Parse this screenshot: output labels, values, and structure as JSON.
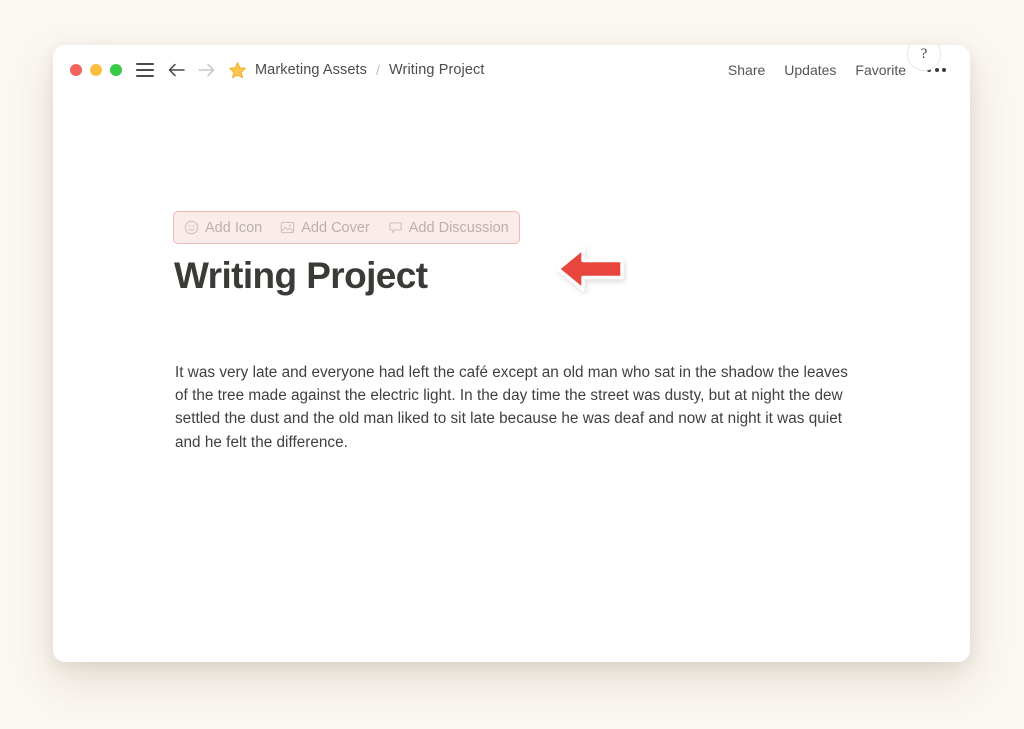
{
  "window": {
    "traffic_lights": [
      {
        "name": "close",
        "color": "#f2645a"
      },
      {
        "name": "minimize",
        "color": "#fcbe40"
      },
      {
        "name": "maximize",
        "color": "#36ca45"
      }
    ],
    "menu_icon": "hamburger-menu-icon",
    "nav": {
      "back_icon": "arrow-left-icon",
      "forward_icon": "arrow-right-icon"
    },
    "favorite_star_icon": "star-icon",
    "breadcrumb": {
      "parent": "Marketing Assets",
      "separator": "/",
      "current": "Writing Project"
    },
    "actions": {
      "share": "Share",
      "updates": "Updates",
      "favorite": "Favorite",
      "more_icon": "ellipsis-icon"
    }
  },
  "page": {
    "action_bar": {
      "highlighted": true,
      "highlight_border_color": "#efb8b4",
      "highlight_fill_color": "#fbeceb",
      "items": [
        {
          "icon": "smiley-face-icon",
          "label": "Add Icon"
        },
        {
          "icon": "image-icon",
          "label": "Add Cover"
        },
        {
          "icon": "speech-bubble-icon",
          "label": "Add Discussion"
        }
      ]
    },
    "annotation": {
      "type": "arrow-left",
      "color": "#e8453c",
      "outline_color": "#ffffff"
    },
    "title": "Writing Project",
    "paragraph": "It was very late and everyone had left the café except an old man who sat in the shadow the leaves of the tree made against the electric light. In the day time the street was dusty, but at night the dew settled the dust and the old man liked to sit late because he was deaf and now at night it was quiet and he felt the difference.",
    "help_button_label": "?"
  },
  "theme": {
    "page_background": "#fbf7f1",
    "window_background": "#ffffff",
    "text_color": "#3f3f3c",
    "muted_text_color": "#b9b0ac"
  }
}
